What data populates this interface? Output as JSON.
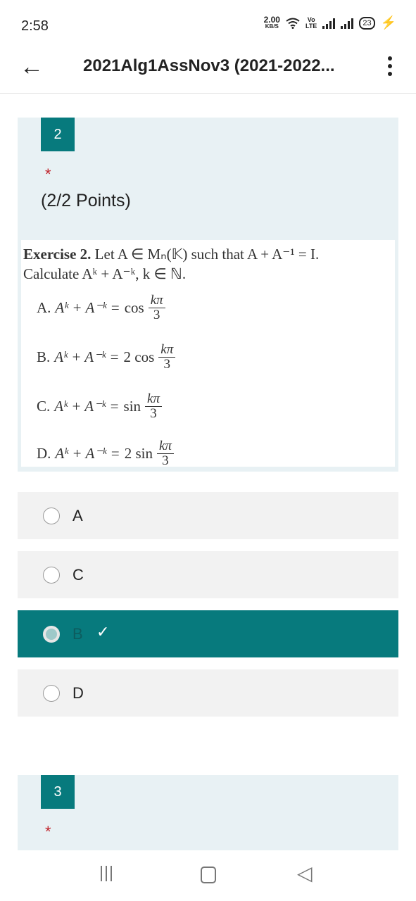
{
  "status_bar": {
    "time": "2:58",
    "speed_value": "2.00",
    "speed_unit": "KB/S",
    "volte_top": "Vo",
    "volte_bottom": "LTE",
    "battery": "23"
  },
  "app_bar": {
    "title": "2021Alg1AssNov3 (2021-2022..."
  },
  "question": {
    "number": "2",
    "required_mark": "*",
    "points": "(2/2 Points)",
    "exercise": {
      "heading": "Exercise 2.",
      "line1": "Let A ∈ Mₙ(𝕂) such that A + A⁻¹ = I.",
      "line2": "Calculate Aᵏ + A⁻ᵏ, k ∈ ℕ.",
      "options": [
        {
          "letter": "A.",
          "lhs": "Aᵏ + A⁻ᵏ = ",
          "func": "cos",
          "num": "kπ",
          "den": "3"
        },
        {
          "letter": "B.",
          "lhs": "Aᵏ + A⁻ᵏ = ",
          "func": "2 cos",
          "num": "kπ",
          "den": "3"
        },
        {
          "letter": "C.",
          "lhs": "Aᵏ + A⁻ᵏ = ",
          "func": "sin",
          "num": "kπ",
          "den": "3"
        },
        {
          "letter": "D.",
          "lhs": "Aᵏ + A⁻ᵏ = ",
          "func": "2 sin",
          "num": "kπ",
          "den": "3"
        }
      ]
    },
    "choices": [
      {
        "label": "A",
        "selected": false
      },
      {
        "label": "C",
        "selected": false
      },
      {
        "label": "B",
        "selected": true,
        "correct_mark": "✓"
      },
      {
        "label": "D",
        "selected": false
      }
    ]
  },
  "next_question": {
    "number": "3",
    "required_mark": "*"
  },
  "colors": {
    "accent": "#077a7d",
    "card_background": "#e8f1f4",
    "required": "#c0262d"
  },
  "nav_icons": [
    "recent-apps-icon",
    "home-icon",
    "back-triangle-icon"
  ]
}
